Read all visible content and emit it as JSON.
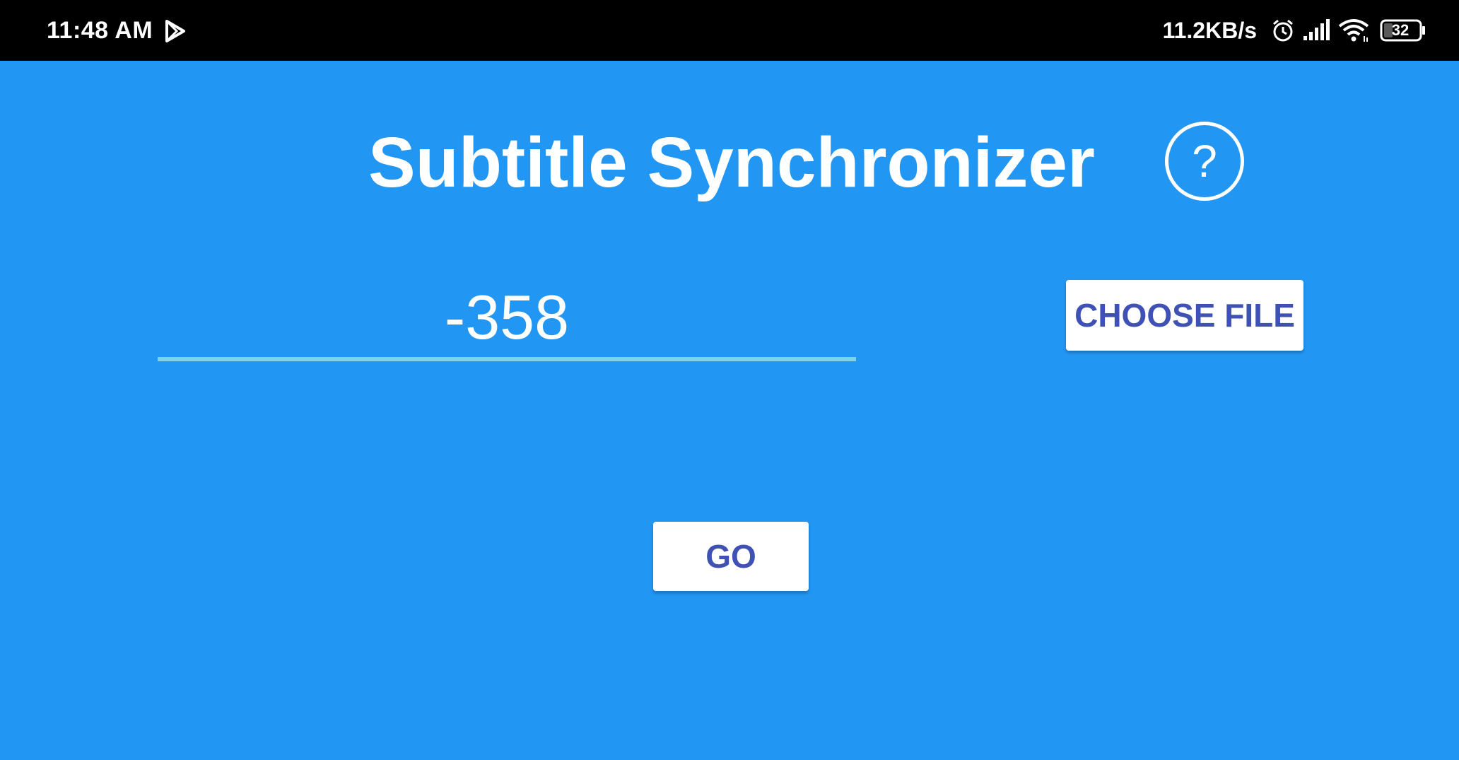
{
  "status_bar": {
    "time": "11:48 AM",
    "net_speed": "11.2KB/s",
    "battery_level": "32",
    "icons": [
      "play-store-icon",
      "alarm-icon",
      "signal-icon",
      "wifi-icon",
      "battery-icon"
    ]
  },
  "app": {
    "title": "Subtitle Synchronizer",
    "help_symbol": "?",
    "background_color": "#2296F3"
  },
  "offset_field": {
    "value": "-358",
    "underline_color": "#7FD3E6"
  },
  "buttons": {
    "choose_file": "CHOOSE FILE",
    "go": "GO",
    "text_color": "#3F51B5"
  }
}
